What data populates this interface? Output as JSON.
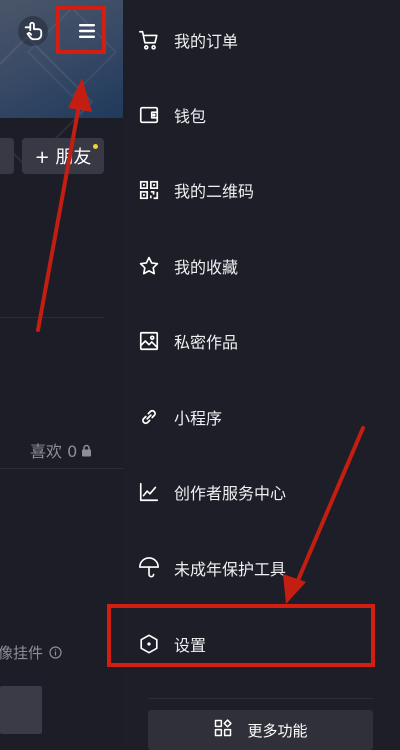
{
  "left": {
    "add_friend_label": "+ 朋友",
    "likes_label": "喜欢 0",
    "widget_label": "像挂件"
  },
  "menu": {
    "items": [
      {
        "label": "我的订单",
        "icon": "cart-icon"
      },
      {
        "label": "钱包",
        "icon": "wallet-icon"
      },
      {
        "label": "我的二维码",
        "icon": "qr-code-icon"
      },
      {
        "label": "我的收藏",
        "icon": "star-icon"
      },
      {
        "label": "私密作品",
        "icon": "private-image-icon"
      },
      {
        "label": "小程序",
        "icon": "mini-program-link-icon"
      },
      {
        "label": "创作者服务中心",
        "icon": "chart-icon"
      },
      {
        "label": "未成年保护工具",
        "icon": "umbrella-icon"
      },
      {
        "label": "设置",
        "icon": "settings-hexagon-icon"
      }
    ],
    "more_label": "更多功能"
  },
  "colors": {
    "background": "#1d1e27",
    "annotation_red": "#d41e12",
    "notification_dot": "#f5d22c"
  }
}
